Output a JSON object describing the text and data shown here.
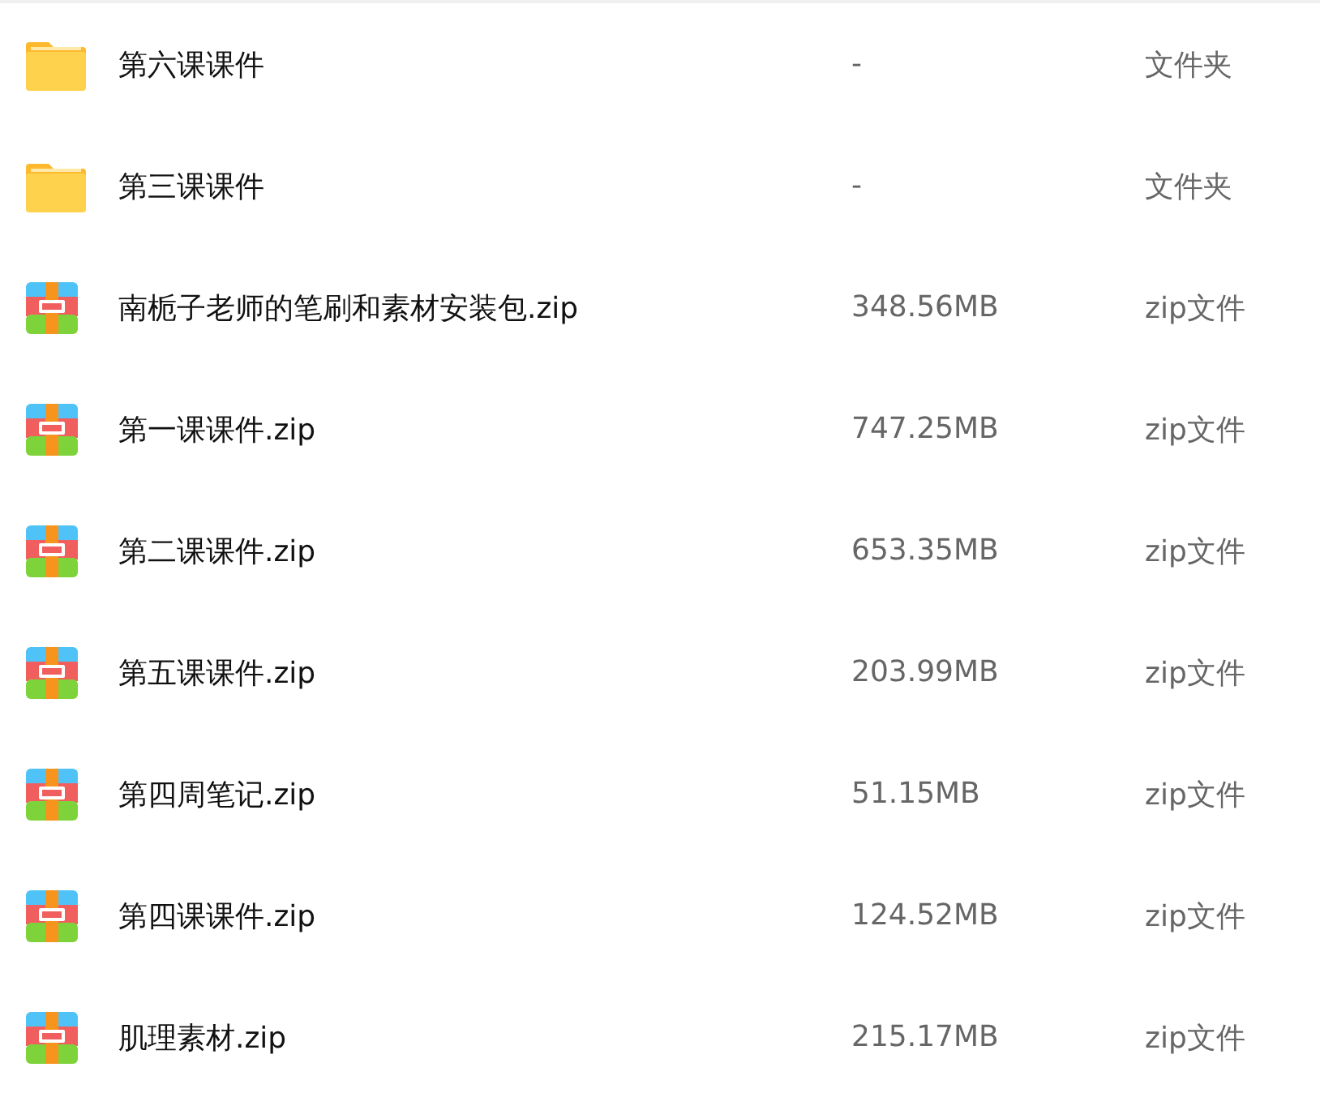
{
  "files": [
    {
      "kind": "folder",
      "name": "第六课课件",
      "size": "-",
      "type": "文件夹"
    },
    {
      "kind": "folder",
      "name": "第三课课件",
      "size": "-",
      "type": "文件夹"
    },
    {
      "kind": "zip",
      "name": "南栀子老师的笔刷和素材安装包.zip",
      "size": "348.56MB",
      "type": "zip文件"
    },
    {
      "kind": "zip",
      "name": "第一课课件.zip",
      "size": "747.25MB",
      "type": "zip文件"
    },
    {
      "kind": "zip",
      "name": "第二课课件.zip",
      "size": "653.35MB",
      "type": "zip文件"
    },
    {
      "kind": "zip",
      "name": "第五课课件.zip",
      "size": "203.99MB",
      "type": "zip文件"
    },
    {
      "kind": "zip",
      "name": "第四周笔记.zip",
      "size": "51.15MB",
      "type": "zip文件"
    },
    {
      "kind": "zip",
      "name": "第四课课件.zip",
      "size": "124.52MB",
      "type": "zip文件"
    },
    {
      "kind": "zip",
      "name": "肌理素材.zip",
      "size": "215.17MB",
      "type": "zip文件"
    }
  ]
}
